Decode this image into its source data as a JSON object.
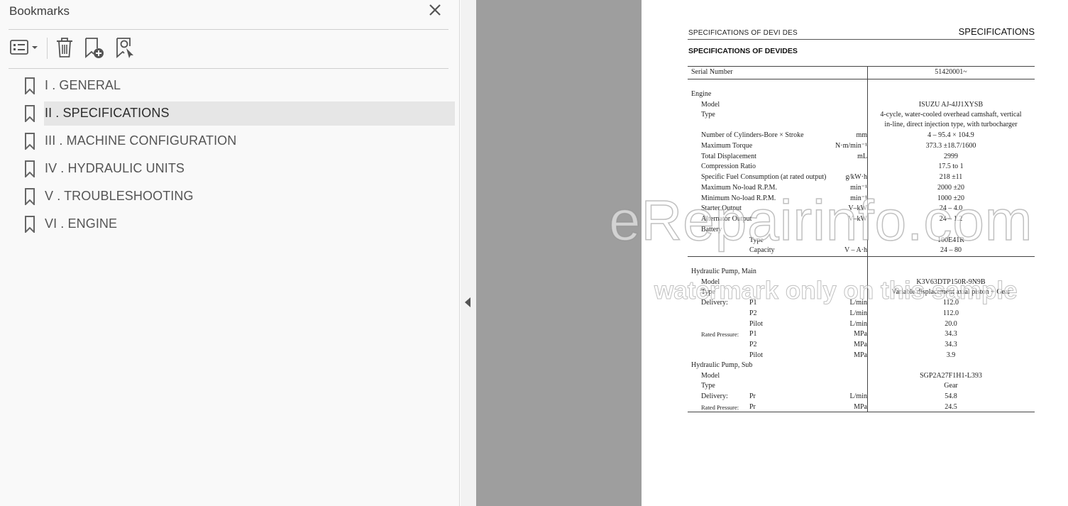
{
  "panel": {
    "title": "Bookmarks",
    "close_icon": "close-icon",
    "toolbar": [
      "options-menu-icon",
      "delete-bookmark-icon",
      "add-bookmark-icon",
      "find-current-bookmark-icon"
    ],
    "bookmarks": [
      {
        "label": "I . GENERAL",
        "selected": false
      },
      {
        "label": "II . SPECIFICATIONS",
        "selected": true
      },
      {
        "label": "III . MACHINE CONFIGURATION",
        "selected": false
      },
      {
        "label": "IV . HYDRAULIC UNITS",
        "selected": false
      },
      {
        "label": "V . TROUBLESHOOTING",
        "selected": false
      },
      {
        "label": "VI . ENGINE",
        "selected": false
      }
    ]
  },
  "document": {
    "header_left": "SPECIFICATIONS OF  DEVI DES",
    "header_right": "SPECIFICATIONS",
    "heading": "SPECIFICATIONS OF DEVIDES",
    "serial_label": "Serial Number",
    "serial_value": "51420001~",
    "engine": {
      "title": "Engine",
      "model_label": "Model",
      "model_value": "ISUZU AJ-4JJ1XYSB",
      "type_label": "Type",
      "type_value_1": "4-cycle, water-cooled overhead camshaft, vertical",
      "type_value_2": "in-line, direct injection type, with turbocharger",
      "rows": [
        {
          "label": "Number of Cylinders-Bore × Stroke",
          "unit": "mm",
          "value": "4 – 95.4 × 104.9"
        },
        {
          "label": "Maximum Torque",
          "unit": "N·m/min⁻¹",
          "value": "373.3 ±18.7/1600"
        },
        {
          "label": "Total Displacement",
          "unit": "mL",
          "value": "2999"
        },
        {
          "label": "Compression Ratio",
          "unit": "",
          "value": "17.5 to 1"
        },
        {
          "label": "Specific Fuel Consumption (at rated output)",
          "unit": "g/kW·h",
          "value": "218 ±11"
        },
        {
          "label": "Maximum No-load R.P.M.",
          "unit": "min⁻¹",
          "value": "2000 ±20"
        },
        {
          "label": "Minimum No-load R.P.M.",
          "unit": "min⁻¹",
          "value": "1000 ±20"
        },
        {
          "label": "Starter  Output",
          "unit": "V–kW",
          "value": "24 – 4.0"
        },
        {
          "label": "Alternator  Output",
          "unit": "V–kW",
          "value": "24 – 1.2"
        }
      ],
      "battery_label": "Battery",
      "battery_type_label": "Type",
      "battery_type_value": "100E41R",
      "battery_cap_label": "Capacity",
      "battery_cap_unit": "V – A·h",
      "battery_cap_value": "24 – 80"
    },
    "pump_main": {
      "title": "Hydraulic Pump, Main",
      "model_label": "Model",
      "model_value": "K3V63DTP150R-9N9B",
      "type_label": "Type",
      "type_value": "Variable displacement axial piston + Gear",
      "delivery_label": "Delivery:",
      "pressure_label": "Rated Pressure:",
      "delivery": [
        {
          "sub": "P1",
          "unit": "L/min",
          "value": "112.0"
        },
        {
          "sub": "P2",
          "unit": "L/min",
          "value": "112.0"
        },
        {
          "sub": "Pilot",
          "unit": "L/min",
          "value": "20.0"
        }
      ],
      "pressure": [
        {
          "sub": "P1",
          "unit": "MPa",
          "value": "34.3"
        },
        {
          "sub": "P2",
          "unit": "MPa",
          "value": "34.3"
        },
        {
          "sub": "Pilot",
          "unit": "MPa",
          "value": "3.9"
        }
      ]
    },
    "pump_sub": {
      "title": "Hydraulic Pump, Sub",
      "model_label": "Model",
      "model_value": "SGP2A27F1H1-L393",
      "type_label": "Type",
      "type_value": "Gear",
      "delivery_label": "Delivery:",
      "delivery_sub": "Pr",
      "delivery_unit": "L/min",
      "delivery_value": "54.8",
      "pressure_label": "Rated Pressure:",
      "pressure_sub": "Pr",
      "pressure_unit": "MPa",
      "pressure_value": "24.5"
    }
  },
  "watermark": {
    "line1": "eRepairinfo.com",
    "line2": "watermark only on this sample"
  }
}
